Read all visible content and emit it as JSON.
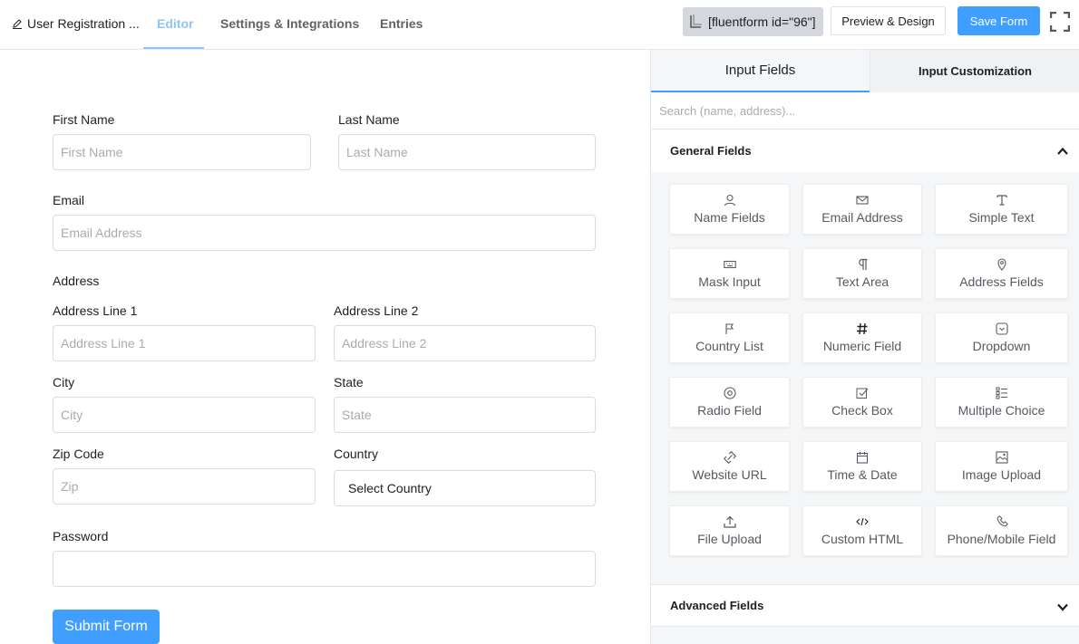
{
  "header": {
    "form_title": "User Registration ...",
    "tabs": [
      {
        "label": "Editor",
        "active": true
      },
      {
        "label": "Settings & Integrations",
        "active": false
      },
      {
        "label": "Entries",
        "active": false
      }
    ],
    "shortcode": "[fluentform id=\"96\"]",
    "preview_label": "Preview & Design",
    "save_label": "Save Form"
  },
  "form": {
    "first_name": {
      "label": "First Name",
      "placeholder": "First Name"
    },
    "last_name": {
      "label": "Last Name",
      "placeholder": "Last Name"
    },
    "email": {
      "label": "Email",
      "placeholder": "Email Address"
    },
    "address_section": "Address",
    "address_line1": {
      "label": "Address Line 1",
      "placeholder": "Address Line 1"
    },
    "address_line2": {
      "label": "Address Line 2",
      "placeholder": "Address Line 2"
    },
    "city": {
      "label": "City",
      "placeholder": "City"
    },
    "state": {
      "label": "State",
      "placeholder": "State"
    },
    "zip": {
      "label": "Zip Code",
      "placeholder": "Zip"
    },
    "country": {
      "label": "Country",
      "value": "Select Country"
    },
    "password": {
      "label": "Password",
      "placeholder": ""
    },
    "submit_label": "Submit Form"
  },
  "panel": {
    "tabs": [
      {
        "label": "Input Fields",
        "active": true
      },
      {
        "label": "Input Customization",
        "active": false
      }
    ],
    "search_placeholder": "Search (name, address)...",
    "general_title": "General Fields",
    "advanced_title": "Advanced Fields",
    "fields": [
      {
        "label": "Name Fields",
        "icon": "user-icon"
      },
      {
        "label": "Email Address",
        "icon": "envelope-icon"
      },
      {
        "label": "Simple Text",
        "icon": "text-icon"
      },
      {
        "label": "Mask Input",
        "icon": "keyboard-icon"
      },
      {
        "label": "Text Area",
        "icon": "paragraph-icon"
      },
      {
        "label": "Address Fields",
        "icon": "map-pin-icon"
      },
      {
        "label": "Country List",
        "icon": "flag-icon"
      },
      {
        "label": "Numeric Field",
        "icon": "hash-icon"
      },
      {
        "label": "Dropdown",
        "icon": "dropdown-icon"
      },
      {
        "label": "Radio Field",
        "icon": "radio-icon"
      },
      {
        "label": "Check Box",
        "icon": "checkbox-icon"
      },
      {
        "label": "Multiple Choice",
        "icon": "list-icon"
      },
      {
        "label": "Website URL",
        "icon": "link-icon"
      },
      {
        "label": "Time & Date",
        "icon": "calendar-icon"
      },
      {
        "label": "Image Upload",
        "icon": "image-icon"
      },
      {
        "label": "File Upload",
        "icon": "upload-icon"
      },
      {
        "label": "Custom HTML",
        "icon": "code-icon"
      },
      {
        "label": "Phone/Mobile Field",
        "icon": "phone-icon"
      }
    ]
  },
  "colors": {
    "accent": "#409eff",
    "tab_active": "#8ec5f7"
  }
}
